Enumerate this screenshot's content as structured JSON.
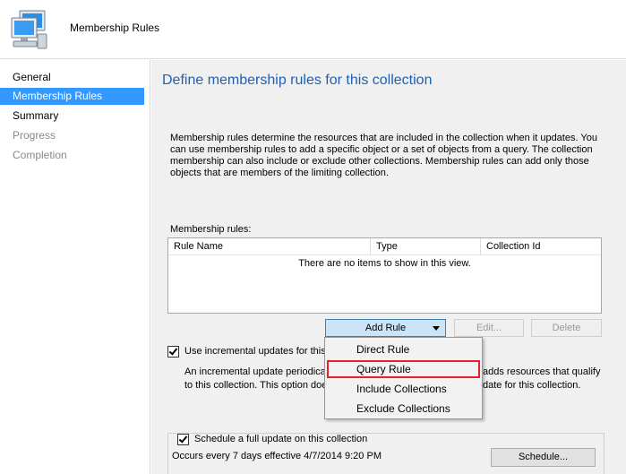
{
  "header": {
    "title": "Membership Rules",
    "icon": "computer-collection-icon"
  },
  "nav": {
    "items": [
      {
        "label": "General",
        "state": "normal"
      },
      {
        "label": "Membership Rules",
        "state": "active"
      },
      {
        "label": "Summary",
        "state": "normal"
      },
      {
        "label": "Progress",
        "state": "disabled"
      },
      {
        "label": "Completion",
        "state": "disabled"
      }
    ]
  },
  "main": {
    "title": "Define membership rules for this collection",
    "description": "Membership rules determine the resources that are included in the collection when it updates. You can use membership rules to add a specific object or a set of objects from a query. The collection membership can also include or exclude other collections. Membership rules can add only those objects that are members of the limiting collection.",
    "rules_label": "Membership rules:",
    "columns": [
      "Rule Name",
      "Type",
      "Collection Id"
    ],
    "empty_message": "There are no items to show in this view.",
    "buttons": {
      "add_rule": "Add Rule",
      "edit": "Edit...",
      "delete": "Delete"
    },
    "incremental": {
      "checked": true,
      "label": "Use incremental updates for this c",
      "desc_line1_left": "An incremental update periodical",
      "desc_line1_right": "adds resources that qualify",
      "desc_line2_left": "to this collection. This option doe",
      "desc_line2_right": "date for this collection."
    },
    "schedule": {
      "checked": true,
      "label": "Schedule a full update on this collection",
      "text": "Occurs every 7 days effective 4/7/2014 9:20 PM",
      "button": "Schedule..."
    }
  },
  "menu": {
    "items": [
      "Direct Rule",
      "Query Rule",
      "Include Collections",
      "Exclude Collections"
    ],
    "highlighted": "Query Rule"
  },
  "colors": {
    "accent": "#3399ff",
    "title_blue": "#1f5fb5",
    "highlight_border": "#e8202a"
  }
}
